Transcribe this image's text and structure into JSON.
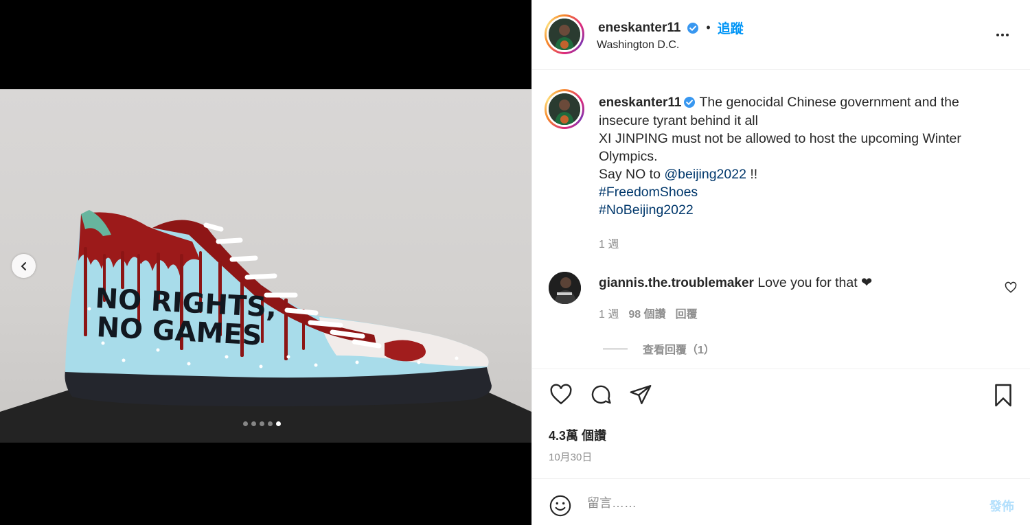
{
  "post": {
    "username": "eneskanter11",
    "separator": "•",
    "follow_label": "追蹤",
    "location": "Washington D.C.",
    "media": {
      "shoe_text_line1": "NO RIGHTS,",
      "shoe_text_line2": "NO GAMES",
      "carousel_total": 5,
      "carousel_active_index": 5
    },
    "caption": {
      "line1": "The genocidal Chinese government and the insecure tyrant behind it all",
      "line2": "XI JINPING must not be allowed to host the upcoming Winter Olympics.",
      "line3_prefix": "Say NO to ",
      "mention": "@beijing2022",
      "line3_suffix": " !!",
      "hashtag1": "#FreedomShoes",
      "hashtag2": "#NoBeijing2022",
      "age": "1 週"
    },
    "comment": {
      "username": "giannis.the.troublemaker",
      "text": "Love you for that ❤",
      "age": "1 週",
      "likes": "98 個讚",
      "reply_label": "回覆",
      "view_replies": "查看回覆（1）"
    },
    "likes_count": "4.3萬 個讚",
    "date": "10月30日",
    "composer": {
      "placeholder": "留言……",
      "post_label": "發佈"
    }
  },
  "colors": {
    "accent_blue": "#0095f6",
    "link_blue": "#00376b",
    "muted_gray": "#8e8e8e"
  }
}
